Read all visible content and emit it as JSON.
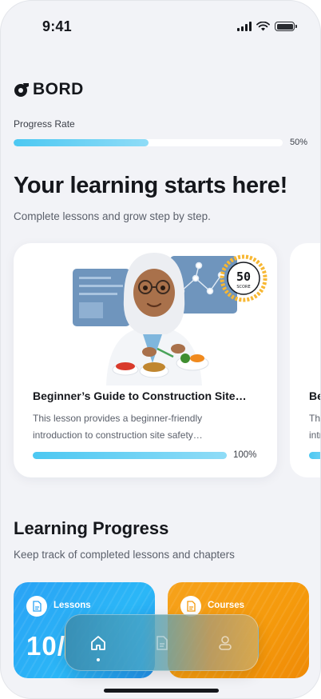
{
  "status_bar": {
    "time": "9:41"
  },
  "brand": {
    "name": "BORD",
    "color": "#15171c"
  },
  "progress_rate": {
    "label": "Progress Rate",
    "value_text": "50%",
    "fraction": 0.5
  },
  "hero": {
    "title": "Your learning starts here!",
    "subtitle": "Complete lessons and grow step by step."
  },
  "lessons": [
    {
      "title": "Beginner’s Guide to Construction Site…",
      "description": "This lesson provides a beginner-friendly introduction to construction site safety…",
      "progress_text": "100%",
      "progress": 1.0,
      "badge_value": "50",
      "badge_label": "SCORE",
      "illustration": "scientist-with-food-icon"
    },
    {
      "title": "Be",
      "description": "Thi intr",
      "progress": 0.15
    }
  ],
  "learning_progress": {
    "title": "Learning Progress",
    "subtitle": "Keep track of completed lessons and chapters",
    "tiles": [
      {
        "label": "Lessons",
        "value": "10/",
        "icon": "document-icon",
        "color": "#2aa2f5"
      },
      {
        "label": "Courses",
        "value": "",
        "icon": "document-icon",
        "color": "#f59a0c"
      }
    ]
  },
  "nav": {
    "items": [
      {
        "name": "home",
        "icon": "home-icon",
        "active": true
      },
      {
        "name": "lessons",
        "icon": "document-icon",
        "active": false
      },
      {
        "name": "profile",
        "icon": "profile-icon",
        "active": false
      }
    ]
  },
  "colors": {
    "accent": "#4cc8f2",
    "background": "#f2f3f7"
  }
}
